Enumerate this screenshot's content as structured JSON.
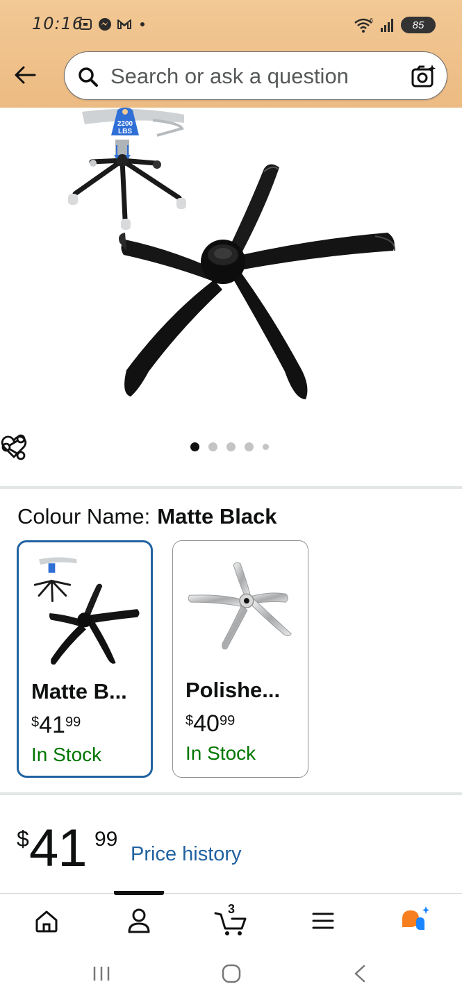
{
  "status_bar": {
    "time": "10:16",
    "battery": "85"
  },
  "search": {
    "placeholder": "Search or ask a question"
  },
  "gallery": {
    "badge_line1": "2200",
    "badge_line2": "LBS",
    "image_count": 5,
    "active_index": 0
  },
  "variation": {
    "label": "Colour Name:",
    "selected": "Matte Black",
    "options": [
      {
        "name": "Matte B...",
        "currency": "$",
        "whole": "41",
        "fraction": "99",
        "stock": "In Stock",
        "selected": true
      },
      {
        "name": "Polishe...",
        "currency": "$",
        "whole": "40",
        "fraction": "99",
        "stock": "In Stock",
        "selected": false
      }
    ]
  },
  "price": {
    "currency": "$",
    "whole": "41",
    "fraction": "99",
    "history_link": "Price history"
  },
  "bottom_nav": {
    "cart_count": "3",
    "items": [
      "home-icon",
      "account-icon",
      "cart-icon",
      "menu-icon",
      "rufus-icon"
    ]
  },
  "colors": {
    "header": "#efc08a",
    "accent_blue": "#2162a1",
    "stock_green": "#007600",
    "rufus_orange": "#f77f1f",
    "rufus_blue": "#1a85ff"
  }
}
